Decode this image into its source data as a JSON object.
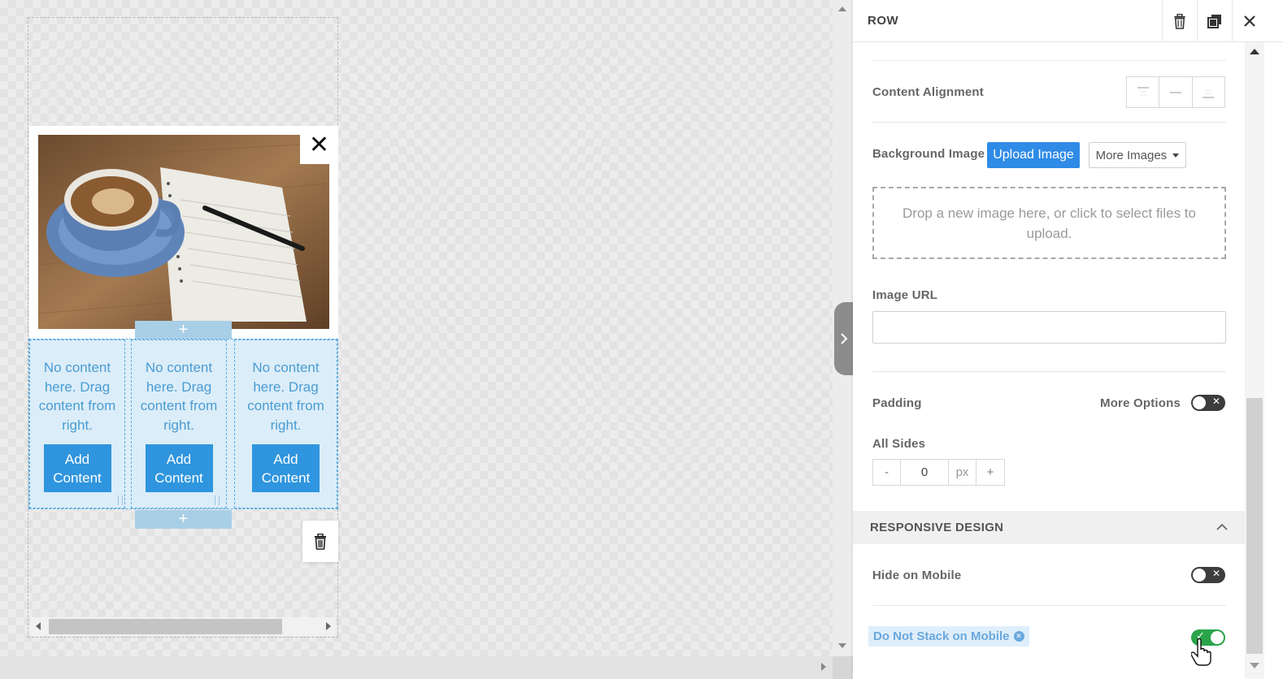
{
  "canvas": {
    "popup_close_glyph": "✕",
    "add_row_glyph": "+",
    "columns": [
      {
        "empty_text": "No content here. Drag content from right.",
        "button_label": "Add Content"
      },
      {
        "empty_text": "No content here. Drag content from right.",
        "button_label": "Add Content"
      },
      {
        "empty_text": "No content here. Drag content from right.",
        "button_label": "Add Content"
      }
    ]
  },
  "panel": {
    "title": "ROW",
    "content_alignment_label": "Content Alignment",
    "background_image_label": "Background Image",
    "upload_button": "Upload Image",
    "more_images_button": "More Images",
    "dropzone_text": "Drop a new image here, or click to select files to upload.",
    "image_url_label": "Image URL",
    "image_url_value": "",
    "padding_label": "Padding",
    "more_options_label": "More Options",
    "more_options_enabled": false,
    "all_sides_label": "All Sides",
    "stepper": {
      "minus": "-",
      "value": "0",
      "unit": "px",
      "plus": "+"
    },
    "responsive_section_title": "RESPONSIVE DESIGN",
    "hide_on_mobile_label": "Hide on Mobile",
    "hide_on_mobile_enabled": false,
    "do_not_stack_label": "Do Not Stack on Mobile",
    "do_not_stack_enabled": true
  },
  "colors": {
    "accent_blue": "#2f8be6",
    "column_bg": "#dbedf8",
    "toggle_on": "#2aa44a",
    "toggle_off": "#3d3d3d"
  }
}
